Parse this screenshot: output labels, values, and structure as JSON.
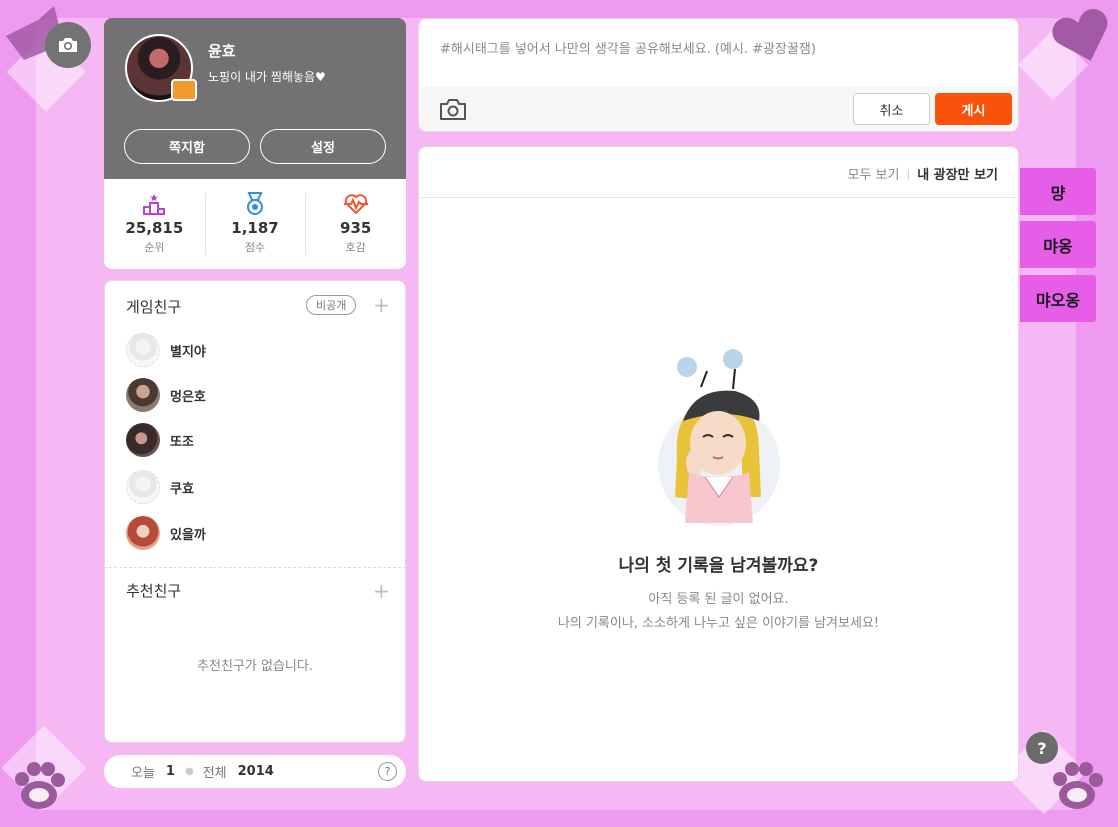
{
  "profile": {
    "name": "윤효",
    "status": "노핑이 내가 찜해놓음♥",
    "message_button": "쪽지함",
    "settings_button": "설정",
    "stats": [
      {
        "icon": "rank-icon",
        "value": "25,815",
        "label": "순위"
      },
      {
        "icon": "medal-icon",
        "value": "1,187",
        "label": "점수"
      },
      {
        "icon": "heartbeat-icon",
        "value": "935",
        "label": "호감"
      }
    ]
  },
  "friends": {
    "title": "게임친구",
    "privacy_badge": "비공개",
    "items": [
      {
        "name": "별지야"
      },
      {
        "name": "멍은호"
      },
      {
        "name": "또조"
      },
      {
        "name": "쿠효"
      },
      {
        "name": "있을까"
      }
    ]
  },
  "recommend": {
    "title": "추천친구",
    "empty": "추천친구가 없습니다."
  },
  "visits": {
    "today_label": "오늘",
    "today_value": "1",
    "total_label": "전체",
    "total_value": "2014",
    "help": "?"
  },
  "compose": {
    "placeholder": "#해시태그를 넣어서 나만의 생각을 공유해보세요. (예시. #광장꿀잼)",
    "cancel": "취소",
    "post": "게시"
  },
  "feed": {
    "filter_all": "모두 보기",
    "filter_mine": "내 광장만 보기",
    "empty_title": "나의 첫 기록을 남겨볼까요?",
    "empty_line1": "아직 등록 된 글이 없어요.",
    "empty_line2": "나의 기록이나, 소소하게 나누고 싶은 이야기를 남겨보세요!"
  },
  "side_tabs": [
    "먕",
    "먀옹",
    "먀오옹"
  ],
  "help_button": "?",
  "colors": {
    "background": "#ee9af0",
    "profile_header": "#737173",
    "post_button": "#fa520b",
    "side_tab": "#e65ee8"
  }
}
